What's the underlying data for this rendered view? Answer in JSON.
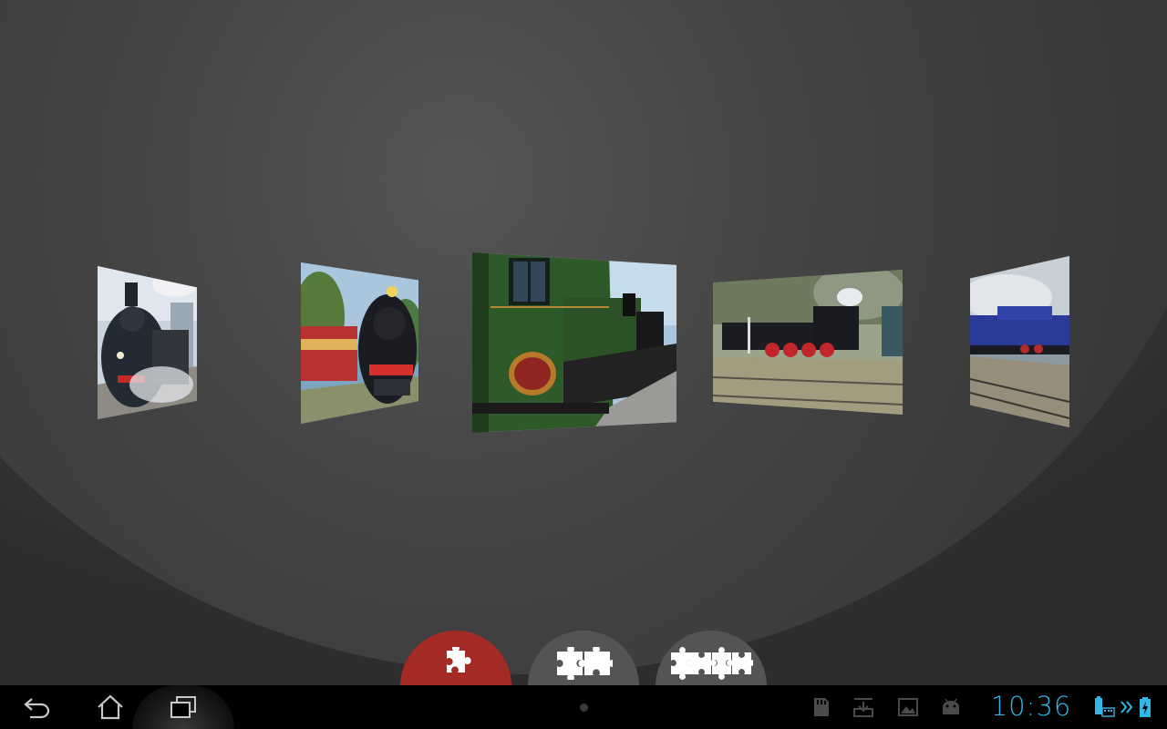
{
  "carousel": {
    "cards": [
      {
        "subject": "steam-locomotive-front-smoke"
      },
      {
        "subject": "black-locomotive-red-carriages"
      },
      {
        "subject": "green-locomotive-nameplate",
        "selected": true
      },
      {
        "subject": "black-locomotive-red-wheels"
      },
      {
        "subject": "blue-locomotive-station"
      }
    ]
  },
  "puzzle_buttons": [
    {
      "icon": "puzzle-single-piece-icon",
      "active": true
    },
    {
      "icon": "puzzle-few-pieces-icon",
      "active": false
    },
    {
      "icon": "puzzle-many-pieces-icon",
      "active": false
    }
  ],
  "system_bar": {
    "clock": "10:36",
    "accent_color": "#33b5e5",
    "nav_icons": [
      "back-icon",
      "home-icon",
      "recent-apps-icon"
    ],
    "status_icons": [
      "sd-card-icon",
      "download-icon",
      "gallery-icon",
      "android-debug-icon",
      "battery-keyboard-icon",
      "charging-battery-icon"
    ]
  },
  "colors": {
    "active_button": "#a32a25",
    "inactive_button": "#545454",
    "background": "#3a3a3a"
  }
}
